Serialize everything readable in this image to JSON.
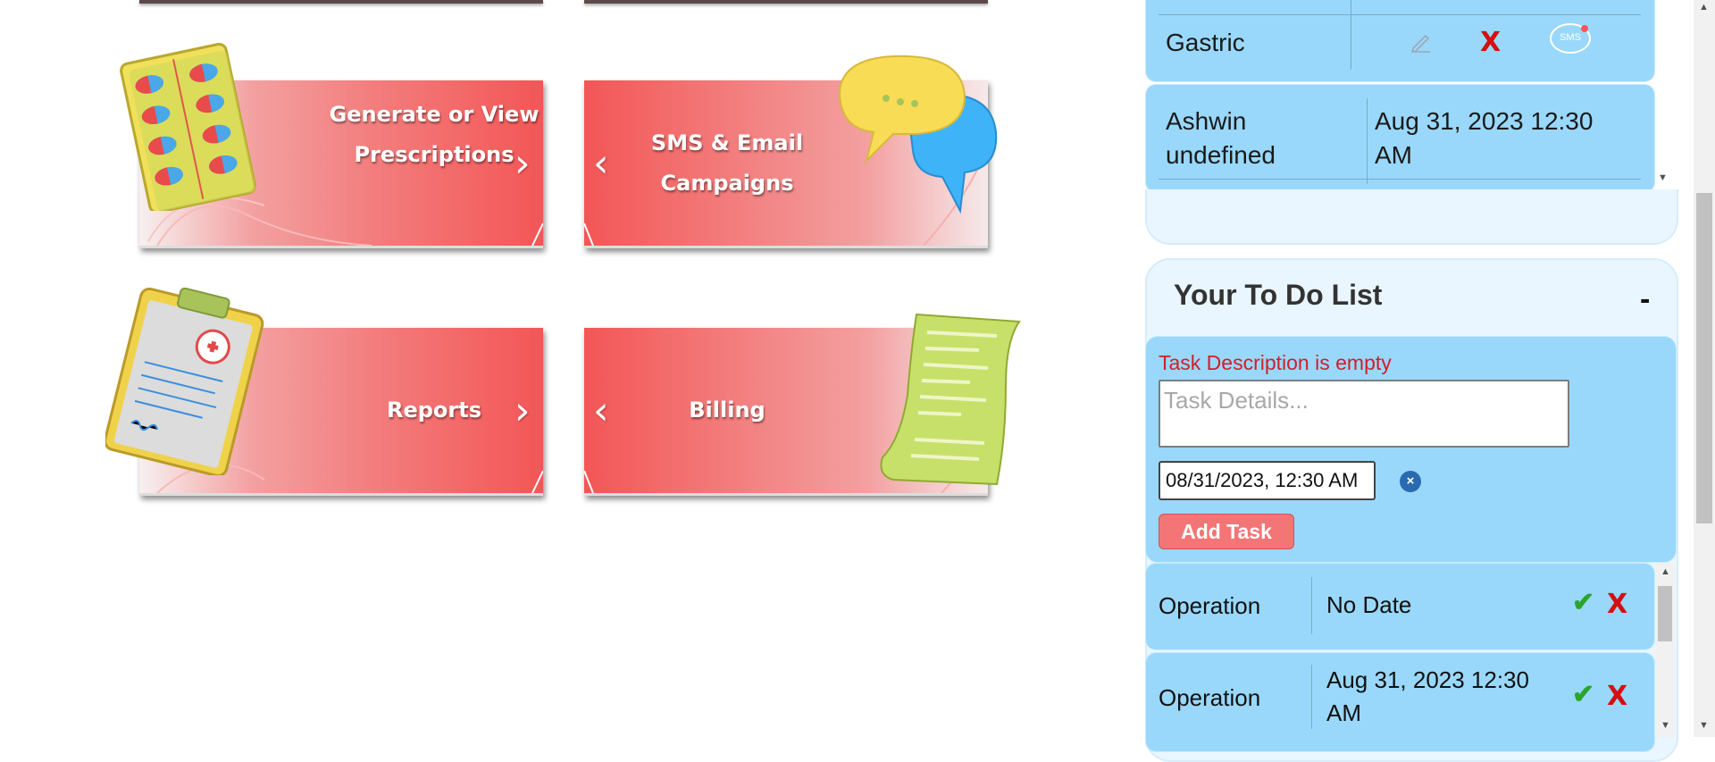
{
  "tiles": [
    {
      "id": "prescriptions",
      "label": "Generate or View Prescriptions",
      "arrow": "›"
    },
    {
      "id": "campaigns",
      "label": "SMS & Email Campaigns",
      "arrow": "‹"
    },
    {
      "id": "reports",
      "label": "Reports",
      "arrow": "›"
    },
    {
      "id": "billing",
      "label": "Billing",
      "arrow": "‹"
    }
  ],
  "appointments": {
    "top_row": {
      "name": "Gastric",
      "edit_icon": "pencil-icon",
      "delete_icon": "x",
      "sms_badge": "SMS"
    },
    "next_row": {
      "name": "Ashwin undefined",
      "date": "Aug 31, 2023 12:30 AM"
    }
  },
  "todo": {
    "title": "Your To Do List",
    "collapse_label": "-",
    "error": "Task Description is empty",
    "task_placeholder": "Task Details...",
    "date_value": "08/31/2023, 12:30 AM",
    "clear_label": "×",
    "add_label": "Add Task",
    "items": [
      {
        "name": "Operation",
        "date": "No Date",
        "check": "✔",
        "delete": "X"
      },
      {
        "name": "Operation",
        "date": "Aug 31, 2023 12:30 AM",
        "check": "✔",
        "delete": "X"
      }
    ]
  },
  "colors": {
    "tile_red": "#f35656",
    "card_blue": "#99d8fb",
    "error_red": "#d21f2b",
    "add_button": "#f47575"
  }
}
